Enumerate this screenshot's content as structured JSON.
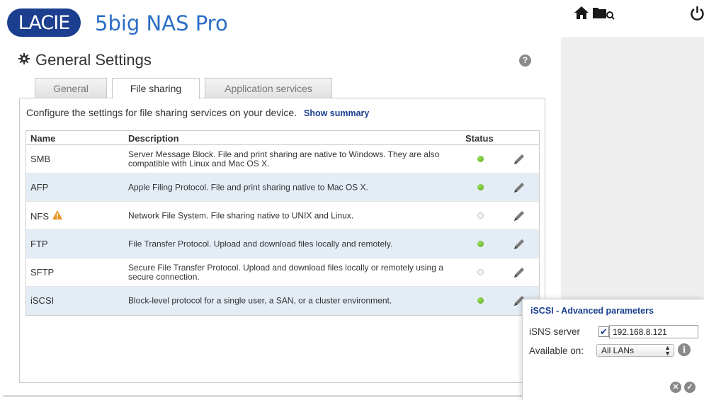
{
  "header": {
    "logo": "LACIE",
    "product": "5big NAS Pro",
    "home_icon": "home-icon",
    "folder_icon": "folder-icon",
    "power_icon": "power-icon"
  },
  "page": {
    "title": "General Settings",
    "title_icon": "gear-icon",
    "help": "?"
  },
  "tabs": [
    {
      "label": "General",
      "active": false
    },
    {
      "label": "File sharing",
      "active": true
    },
    {
      "label": "Application services",
      "active": false
    }
  ],
  "content": {
    "intro": "Configure the settings for file sharing services on your device.",
    "show_summary": "Show summary"
  },
  "table": {
    "headers": {
      "name": "Name",
      "description": "Description",
      "status": "Status"
    },
    "rows": [
      {
        "name": "SMB",
        "description": "Server Message Block. File and print sharing are native to Windows. They are also compatible with Linux and Mac OS X.",
        "status": "on"
      },
      {
        "name": "AFP",
        "description": "Apple Filing Protocol. File and print sharing native to Mac OS X.",
        "status": "on"
      },
      {
        "name": "NFS",
        "description": "Network File System. File sharing native to UNIX and Linux.",
        "status": "off",
        "warning": true
      },
      {
        "name": "FTP",
        "description": "File Transfer Protocol. Upload and download files locally and remotely.",
        "status": "on"
      },
      {
        "name": "SFTP",
        "description": "Secure File Transfer Protocol. Upload and download files locally or remotely using a secure connection.",
        "status": "off"
      },
      {
        "name": "iSCSI",
        "description": "Block-level protocol for a single user, a SAN, or a cluster environment.",
        "status": "on"
      }
    ]
  },
  "popup": {
    "title": "iSCSI - Advanced parameters",
    "isns_label": "iSNS server",
    "isns_checked": true,
    "isns_value": "192.168.8.121",
    "available_label": "Available on:",
    "available_value": "All LANs",
    "info": "i",
    "cancel_icon": "cancel-icon",
    "confirm_icon": "confirm-icon"
  },
  "colors": {
    "brand_blue": "#1b3f8e",
    "product_blue": "#2a6ec6",
    "status_on": "#6ab82c",
    "row_alt": "#e4edf6"
  }
}
